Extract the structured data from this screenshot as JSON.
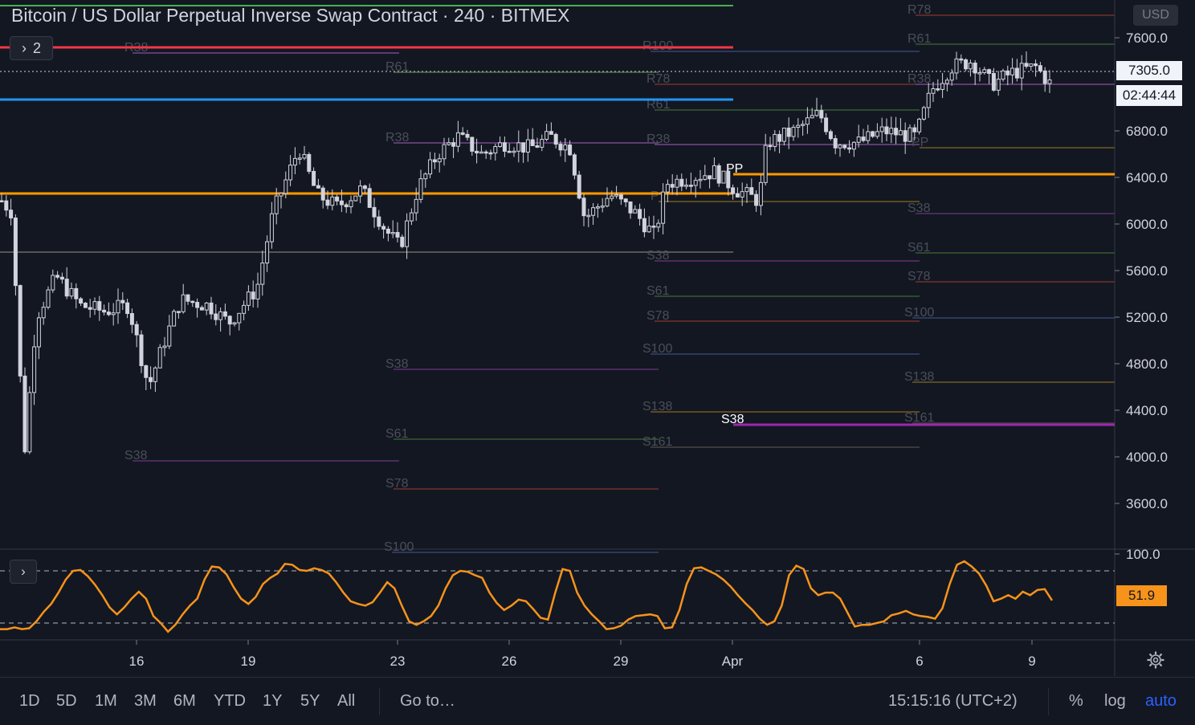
{
  "header": {
    "title": "Bitcoin / US Dollar Perpetual Inverse Swap Contract · 240 · BITMEX",
    "legend_toggle": "2",
    "currency": "USD"
  },
  "price_scale": {
    "last_price": "7305.0",
    "countdown": "02:44:44",
    "oscillator_value": "51.9"
  },
  "bottom_bar": {
    "timeframes": [
      "1D",
      "5D",
      "1M",
      "3M",
      "6M",
      "YTD",
      "1Y",
      "5Y",
      "All"
    ],
    "goto": "Go to…",
    "clock": "15:15:16 (UTC+2)",
    "percent": "%",
    "log": "log",
    "auto": "auto"
  },
  "colors": {
    "background": "#131722",
    "candle": "#d1d4dc",
    "red_line": "#f23645",
    "blue_line": "#2196f3",
    "orange_line": "#ff9800",
    "green_line": "#4caf50",
    "purple_line": "#9c27b0",
    "oscillator": "#f7931a"
  },
  "chart_data": {
    "type": "candlestick",
    "y_ticks": [
      7600,
      7200,
      6800,
      6400,
      6000,
      5600,
      5200,
      4800,
      4400,
      4000,
      3600
    ],
    "y_tick_labels": [
      "7600.0",
      "6800.0",
      "6400.0",
      "6000.0",
      "5600.0",
      "5200.0",
      "4800.0",
      "4400.0",
      "4000.0",
      "3600.0"
    ],
    "ylim": [
      3300,
      7900
    ],
    "x_tick_labels": [
      "16",
      "19",
      "23",
      "26",
      "29",
      "Apr",
      "6",
      "9"
    ],
    "horizontal_levels": [
      {
        "price": 7900,
        "color": "#4caf50"
      },
      {
        "price": 7520,
        "color": "#f23645"
      },
      {
        "price": 7080,
        "color": "#2196f3"
      },
      {
        "price": 6270,
        "color": "#ff9800",
        "x_end": "Apr"
      },
      {
        "price": 6420,
        "color": "#ff9800",
        "x_start": "Apr"
      },
      {
        "price": 4270,
        "color": "#9c27b0",
        "label": "S38",
        "x_start": "Apr"
      }
    ],
    "pivot_labels": [
      {
        "text": "R38",
        "price": 7510
      },
      {
        "text": "S38",
        "price": 4030
      },
      {
        "text": "R61",
        "price": 7340
      },
      {
        "text": "R38",
        "price": 6800
      },
      {
        "text": "S38",
        "price": 4780
      },
      {
        "text": "S61",
        "price": 4210
      },
      {
        "text": "S78",
        "price": 3820
      },
      {
        "text": "S100",
        "price": 3300
      },
      {
        "text": "R100",
        "price": 7520
      },
      {
        "text": "R78",
        "price": 7250
      },
      {
        "text": "R61",
        "price": 7050
      },
      {
        "text": "R38",
        "price": 6780
      },
      {
        "text": "P",
        "price": 6240
      },
      {
        "text": "S38",
        "price": 5740
      },
      {
        "text": "S61",
        "price": 5360
      },
      {
        "text": "S78",
        "price": 5140
      },
      {
        "text": "S100",
        "price": 4920
      },
      {
        "text": "S138",
        "price": 4490
      },
      {
        "text": "S161",
        "price": 4130
      },
      {
        "text": "PP",
        "price": 6470
      },
      {
        "text": "R78",
        "price": 7930
      },
      {
        "text": "R61",
        "price": 7590
      },
      {
        "text": "R38",
        "price": 7250
      },
      {
        "text": "PP",
        "price": 6710
      },
      {
        "text": "S38",
        "price": 6130
      },
      {
        "text": "S61",
        "price": 5790
      },
      {
        "text": "S78",
        "price": 5540
      },
      {
        "text": "S100",
        "price": 5230
      },
      {
        "text": "S138",
        "price": 4700
      },
      {
        "text": "S161",
        "price": 4350
      }
    ],
    "oscillator": {
      "ylim": [
        0,
        100
      ],
      "tick_label": "100.0",
      "upper_band": 80,
      "lower_band": 20,
      "values": [
        13,
        13,
        15,
        13,
        14,
        22,
        33,
        42,
        55,
        70,
        80,
        81,
        74,
        64,
        52,
        38,
        30,
        38,
        48,
        56,
        48,
        28,
        20,
        10,
        18,
        30,
        40,
        48,
        70,
        85,
        84,
        76,
        61,
        48,
        42,
        50,
        65,
        72,
        77,
        88,
        87,
        81,
        80,
        83,
        81,
        77,
        67,
        55,
        45,
        42,
        40,
        44,
        55,
        67,
        60,
        40,
        22,
        18,
        22,
        28,
        40,
        60,
        75,
        80,
        79,
        75,
        72,
        55,
        43,
        35,
        40,
        47,
        45,
        36,
        26,
        24,
        55,
        82,
        80,
        55,
        40,
        30,
        22,
        13,
        14,
        17,
        24,
        28,
        29,
        30,
        28,
        14,
        15,
        35,
        65,
        83,
        84,
        80,
        76,
        70,
        62,
        52,
        43,
        35,
        25,
        18,
        22,
        40,
        75,
        86,
        82,
        60,
        52,
        55,
        55,
        48,
        32,
        16,
        18,
        18,
        20,
        22,
        29,
        31,
        34,
        30,
        28,
        27,
        25,
        37,
        65,
        87,
        91,
        85,
        77,
        63,
        45,
        48,
        52,
        48,
        56,
        52,
        58,
        59,
        46
      ]
    },
    "candles_source": "approximate 4h candles reconstructed from price path"
  }
}
